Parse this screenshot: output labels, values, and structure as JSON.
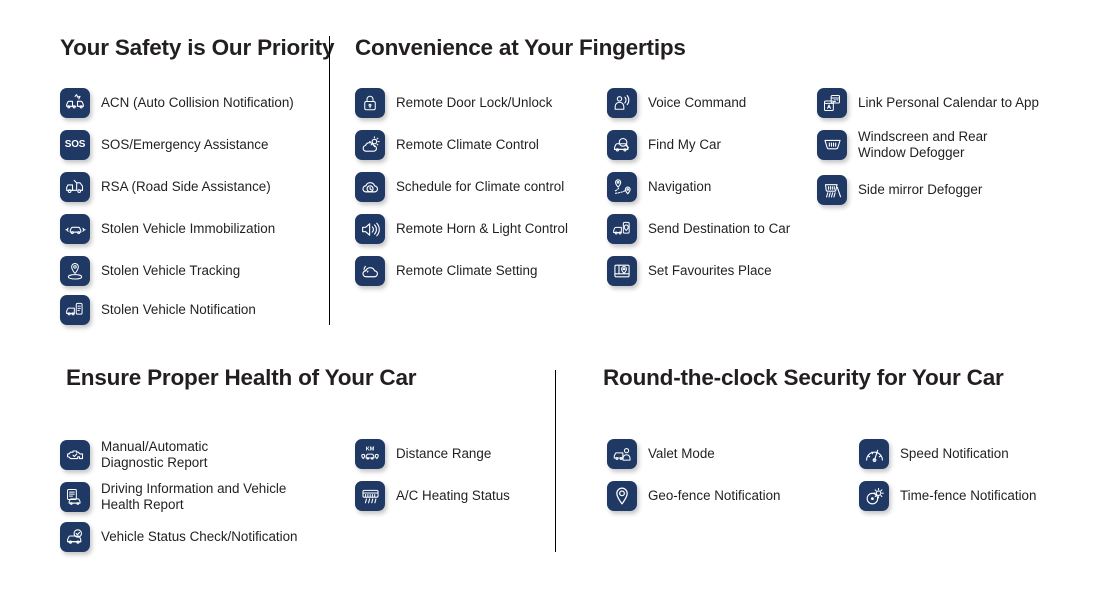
{
  "page": {
    "background": "#ffffff",
    "icon_tile_color": "#1f3864",
    "icon_glyph_color": "#ffffff",
    "text_color": "#231f20",
    "divider_color": "#000000"
  },
  "sections": [
    {
      "id": "safety",
      "heading": "Your Safety is Our Priority",
      "columns": [
        {
          "items": [
            {
              "label": "ACN (Auto Collision Notification)",
              "icon": "collision-cars-icon"
            },
            {
              "label": "SOS/Emergency Assistance",
              "icon": "sos-icon"
            },
            {
              "label": "RSA (Road Side Assistance)",
              "icon": "tow-truck-icon"
            },
            {
              "label": "Stolen Vehicle Immobilization",
              "icon": "car-immobilize-icon"
            },
            {
              "label": "Stolen Vehicle Tracking",
              "icon": "car-tracking-pin-icon"
            },
            {
              "label": "Stolen Vehicle Notification",
              "icon": "car-notification-icon"
            }
          ]
        }
      ]
    },
    {
      "id": "convenience",
      "heading": "Convenience at Your Fingertips",
      "columns": [
        {
          "items": [
            {
              "label": "Remote Door Lock/Unlock",
              "icon": "padlock-icon"
            },
            {
              "label": "Remote Climate Control",
              "icon": "cloud-sun-icon"
            },
            {
              "label": "Schedule for Climate control",
              "icon": "cloud-schedule-icon"
            },
            {
              "label": "Remote Horn & Light Control",
              "icon": "horn-speaker-icon"
            },
            {
              "label": "Remote Climate Setting",
              "icon": "cloud-signal-icon"
            }
          ]
        },
        {
          "items": [
            {
              "label": "Voice Command",
              "icon": "voice-person-icon"
            },
            {
              "label": "Find My Car",
              "icon": "car-magnifier-icon"
            },
            {
              "label": "Navigation",
              "icon": "route-pin-icon"
            },
            {
              "label": "Send Destination to Car",
              "icon": "send-destination-car-icon"
            },
            {
              "label": "Set Favourites Place",
              "icon": "map-favourite-icon"
            }
          ]
        },
        {
          "items": [
            {
              "label": "Link Personal Calendar to App",
              "icon": "calendar-link-icon"
            },
            {
              "label": "Windscreen and Rear\nWindow Defogger",
              "icon": "windscreen-defogger-icon"
            },
            {
              "label": "Side mirror Defogger",
              "icon": "side-mirror-defogger-icon"
            }
          ]
        }
      ]
    },
    {
      "id": "health",
      "heading": "Ensure Proper Health of Your Car",
      "columns": [
        {
          "items": [
            {
              "label": "Manual/Automatic\nDiagnostic Report",
              "icon": "engine-check-icon"
            },
            {
              "label": "Driving Information and Vehicle\nHealth Report",
              "icon": "driving-report-icon"
            },
            {
              "label": "Vehicle Status Check/Notification",
              "icon": "car-status-check-icon"
            }
          ]
        },
        {
          "items": [
            {
              "label": "Distance Range",
              "icon": "km-range-icon"
            },
            {
              "label": "A/C Heating Status",
              "icon": "ac-heating-icon"
            }
          ]
        }
      ]
    },
    {
      "id": "security",
      "heading": "Round-the-clock Security for Your Car",
      "columns": [
        {
          "items": [
            {
              "label": "Valet Mode",
              "icon": "valet-car-icon"
            },
            {
              "label": "Geo-fence Notification",
              "icon": "geo-pin-icon"
            }
          ]
        },
        {
          "items": [
            {
              "label": "Speed Notification",
              "icon": "speed-gauge-icon"
            },
            {
              "label": "Time-fence Notification",
              "icon": "time-gear-icon"
            }
          ]
        }
      ]
    }
  ]
}
